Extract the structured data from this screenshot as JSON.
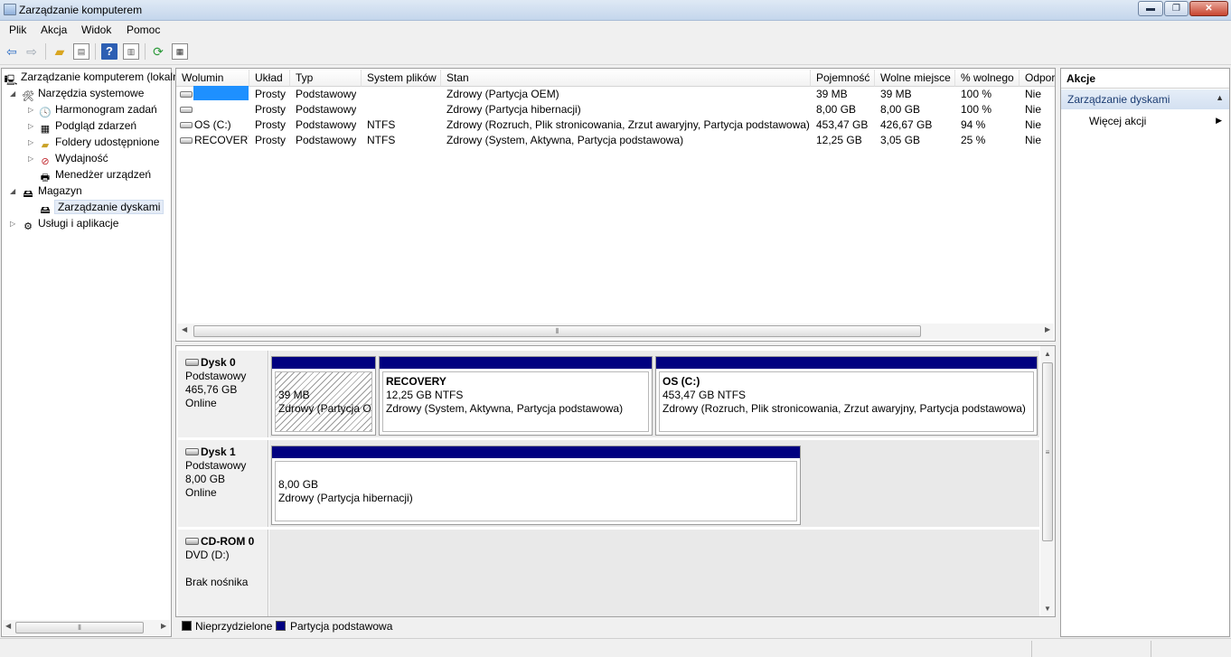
{
  "window": {
    "title": "Zarządzanie komputerem",
    "minimize_glyph": "▬",
    "restore_glyph": "❐",
    "close_glyph": "✕"
  },
  "menu": [
    "Plik",
    "Akcja",
    "Widok",
    "Pomoc"
  ],
  "toolbar": {
    "icons": [
      "back-arrow-icon",
      "forward-arrow-icon",
      "up-folder-icon",
      "show-hide-tree-icon",
      "help-icon",
      "show-hide-action-pane-icon",
      "refresh-icon",
      "properties-icon"
    ]
  },
  "tree": {
    "root": "Zarządzanie komputerem (lokalny)",
    "system_tools": "Narzędzia systemowe",
    "task_scheduler": "Harmonogram zadań",
    "event_viewer": "Podgląd zdarzeń",
    "shared_folders": "Foldery udostępnione",
    "performance": "Wydajność",
    "device_manager": "Menedżer urządzeń",
    "storage": "Magazyn",
    "disk_management": "Zarządzanie dyskami",
    "services_apps": "Usługi i aplikacje"
  },
  "volume_list": {
    "columns": [
      "Wolumin",
      "Układ",
      "Typ",
      "System plików",
      "Stan",
      "Pojemność",
      "Wolne miejsce",
      "% wolnego",
      "Odpor"
    ],
    "rows": [
      {
        "volume": "",
        "layout": "Prosty",
        "type": "Podstawowy",
        "fs": "",
        "status": "Zdrowy (Partycja OEM)",
        "capacity": "39 MB",
        "free": "39 MB",
        "pct": "100 %",
        "fault": "Nie"
      },
      {
        "volume": "",
        "layout": "Prosty",
        "type": "Podstawowy",
        "fs": "",
        "status": "Zdrowy (Partycja hibernacji)",
        "capacity": "8,00 GB",
        "free": "8,00 GB",
        "pct": "100 %",
        "fault": "Nie"
      },
      {
        "volume": "OS (C:)",
        "layout": "Prosty",
        "type": "Podstawowy",
        "fs": "NTFS",
        "status": "Zdrowy (Rozruch, Plik stronicowania, Zrzut awaryjny, Partycja podstawowa)",
        "capacity": "453,47 GB",
        "free": "426,67 GB",
        "pct": "94 %",
        "fault": "Nie"
      },
      {
        "volume": "RECOVERY",
        "layout": "Prosty",
        "type": "Podstawowy",
        "fs": "NTFS",
        "status": "Zdrowy (System, Aktywna, Partycja podstawowa)",
        "capacity": "12,25 GB",
        "free": "3,05 GB",
        "pct": "25 %",
        "fault": "Nie"
      }
    ]
  },
  "disks": [
    {
      "name": "Dysk 0",
      "type": "Podstawowy",
      "size": "465,76 GB",
      "state": "Online",
      "partitions": [
        {
          "title": "",
          "size": "39 MB",
          "status": "Zdrowy (Partycja OEM)"
        },
        {
          "title": "RECOVERY",
          "size": "12,25 GB NTFS",
          "status": "Zdrowy (System, Aktywna, Partycja podstawowa)"
        },
        {
          "title": "OS  (C:)",
          "size": "453,47 GB NTFS",
          "status": "Zdrowy (Rozruch, Plik stronicowania, Zrzut awaryjny, Partycja podstawowa)"
        }
      ]
    },
    {
      "name": "Dysk 1",
      "type": "Podstawowy",
      "size": "8,00 GB",
      "state": "Online",
      "partitions": [
        {
          "title": "",
          "size": "8,00 GB",
          "status": "Zdrowy (Partycja hibernacji)"
        }
      ]
    },
    {
      "name": "CD-ROM 0",
      "type": "DVD (D:)",
      "size": "",
      "state": "Brak nośnika",
      "partitions": []
    }
  ],
  "legend": [
    {
      "label": "Nieprzydzielone",
      "color": "#000000"
    },
    {
      "label": "Partycja podstawowa",
      "color": "#000080"
    }
  ],
  "actions": {
    "header": "Akcje",
    "section": "Zarządzanie dyskami",
    "more": "Więcej akcji"
  },
  "colors": {
    "primary_partition": "#000080",
    "selection": "#e5ecf7",
    "action_section": "#dde7f4"
  }
}
